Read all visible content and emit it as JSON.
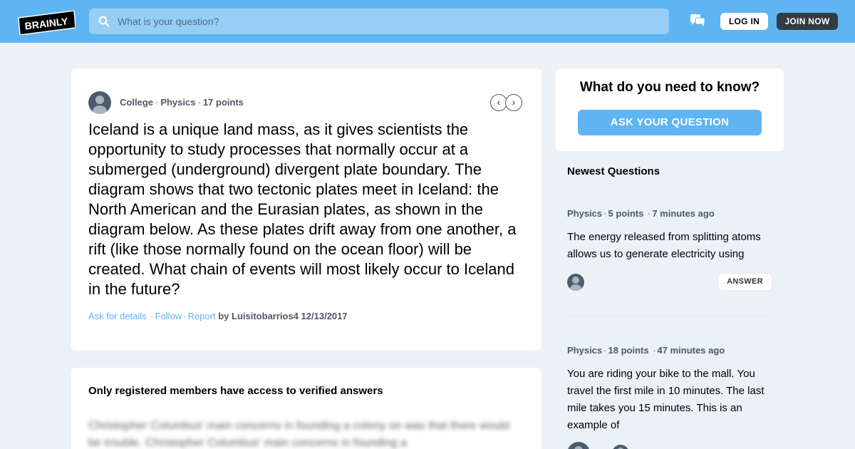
{
  "header": {
    "logo_text": "BRAINLY",
    "search_placeholder": "What is your question?",
    "login_label": "LOG IN",
    "join_label": "JOIN NOW"
  },
  "question": {
    "grade": "College",
    "subject": "Physics",
    "points": "17 points",
    "text": "Iceland is a unique land mass, as it gives scientists the opportunity to study processes that normally occur at a submerged (underground) divergent plate boundary. The diagram shows that two tectonic plates meet in Iceland: the North American and the Eurasian plates, as shown in the diagram below. As these plates drift away from one another, a rift (like those normally found on the ocean floor) will be created. What chain of events will most likely occur to Iceland in the future?",
    "actions": {
      "ask_details": "Ask for details",
      "follow": "Follow",
      "report": "Report",
      "by": "by",
      "author": "Luisitobarrios4",
      "date": "12/13/2017"
    }
  },
  "registered": {
    "title": "Only registered members have access to verified answers",
    "blurred_text": "Christopher Columbus' main concerns in founding a colony on was that there would be trouble. Christopher Columbus' main concerns in founding a"
  },
  "ask": {
    "title": "What do you need to know?",
    "button": "ASK YOUR QUESTION"
  },
  "newest": {
    "title": "Newest Questions",
    "items": [
      {
        "subject": "Physics",
        "points": "5 points",
        "time": "7 minutes ago",
        "text": "The energy released from splitting atoms allows us to generate electricity using",
        "answer_label": "ANSWER"
      },
      {
        "subject": "Physics",
        "points": "18 points",
        "time": "47 minutes ago",
        "text": "You are riding your bike to the mall. You travel the first mile in 10 minutes. The last mile takes you 15 minutes. This is an example of"
      }
    ]
  },
  "colors": {
    "brand_blue": "#5fb4f2",
    "dark": "#323c45",
    "background": "#ebf2f7"
  }
}
